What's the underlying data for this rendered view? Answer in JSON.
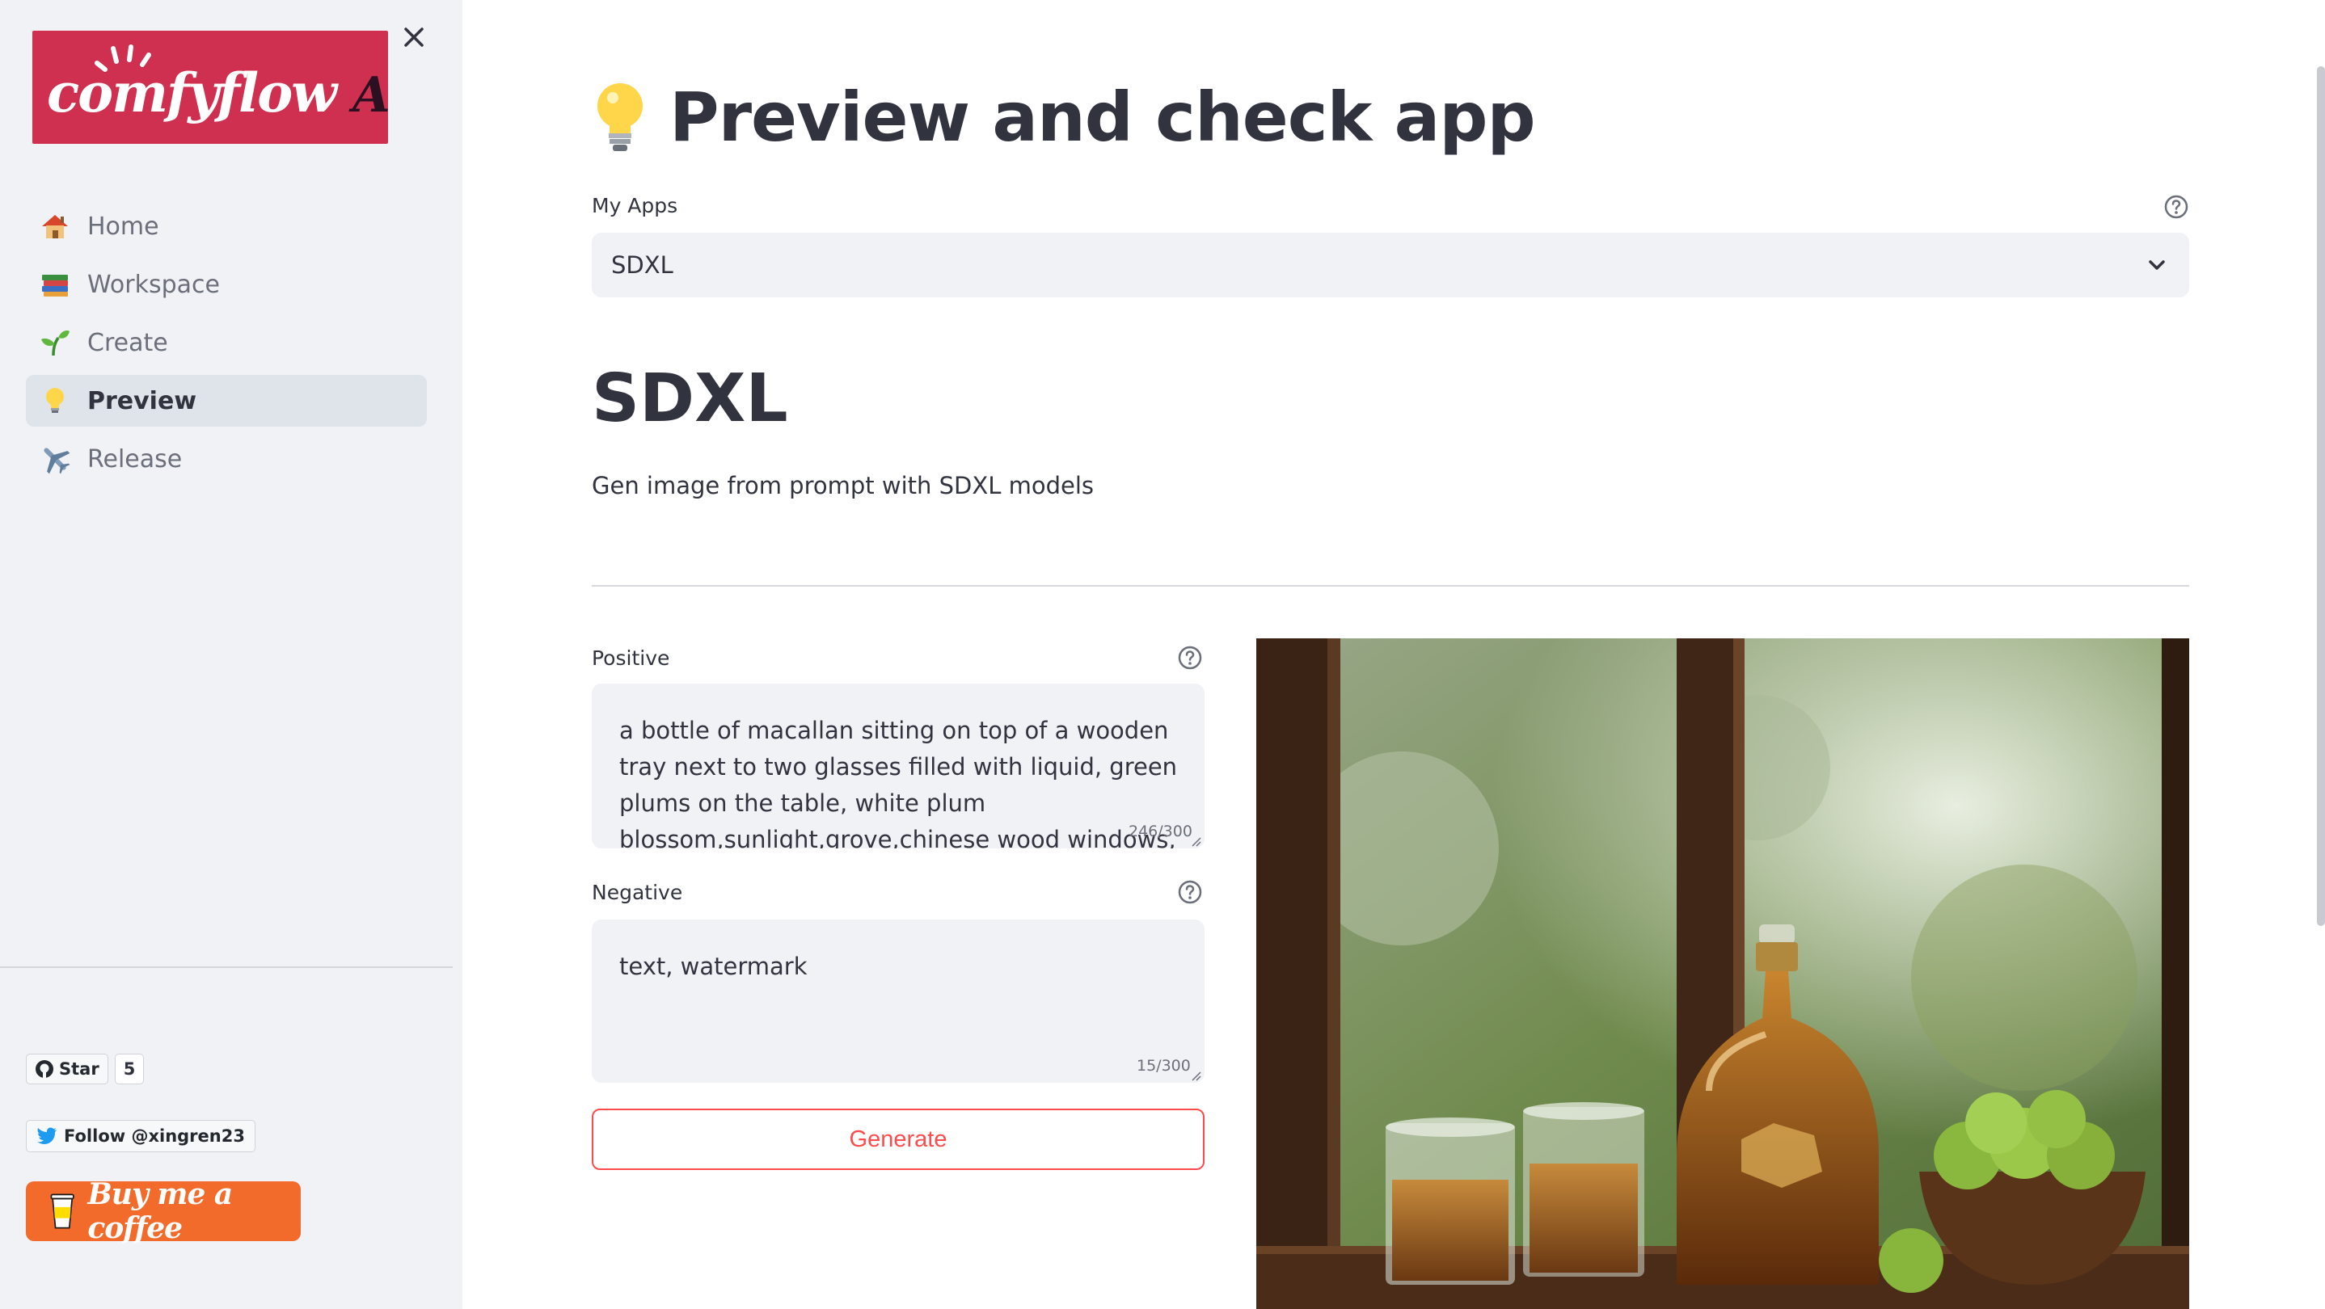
{
  "sidebar": {
    "logo_text": "comfyflow",
    "logo_app": "App",
    "close_label": "×",
    "nav": [
      {
        "label": "Home",
        "icon": "house-icon",
        "active": false
      },
      {
        "label": "Workspace",
        "icon": "books-icon",
        "active": false
      },
      {
        "label": "Create",
        "icon": "seedling-icon",
        "active": false
      },
      {
        "label": "Preview",
        "icon": "lightbulb-icon",
        "active": true
      },
      {
        "label": "Release",
        "icon": "airplane-icon",
        "active": false
      }
    ],
    "github": {
      "label": "Star",
      "count": "5"
    },
    "twitter": {
      "label": "Follow @xingren23"
    },
    "bmc": {
      "label": "Buy me a coffee"
    }
  },
  "main": {
    "title": "Preview and check app",
    "title_icon": "lightbulb-icon",
    "my_apps": {
      "label": "My Apps",
      "value": "SDXL"
    },
    "app": {
      "name": "SDXL",
      "description": "Gen image from prompt with SDXL models"
    },
    "positive": {
      "label": "Positive",
      "value": "a bottle of macallan sitting on top of a wooden tray next to two glasses filled with liquid,  green plums on the table,   white plum blossom,sunlight,grove,chinese wood windows,",
      "counter": "246/300"
    },
    "negative": {
      "label": "Negative",
      "value": "text, watermark",
      "counter": "15/300"
    },
    "generate_label": "Generate"
  },
  "colors": {
    "sidebar_bg": "#f0f2f6",
    "logo_bg": "#d0304f",
    "accent": "#ff4b4b",
    "bmc_bg": "#f26b2a"
  }
}
